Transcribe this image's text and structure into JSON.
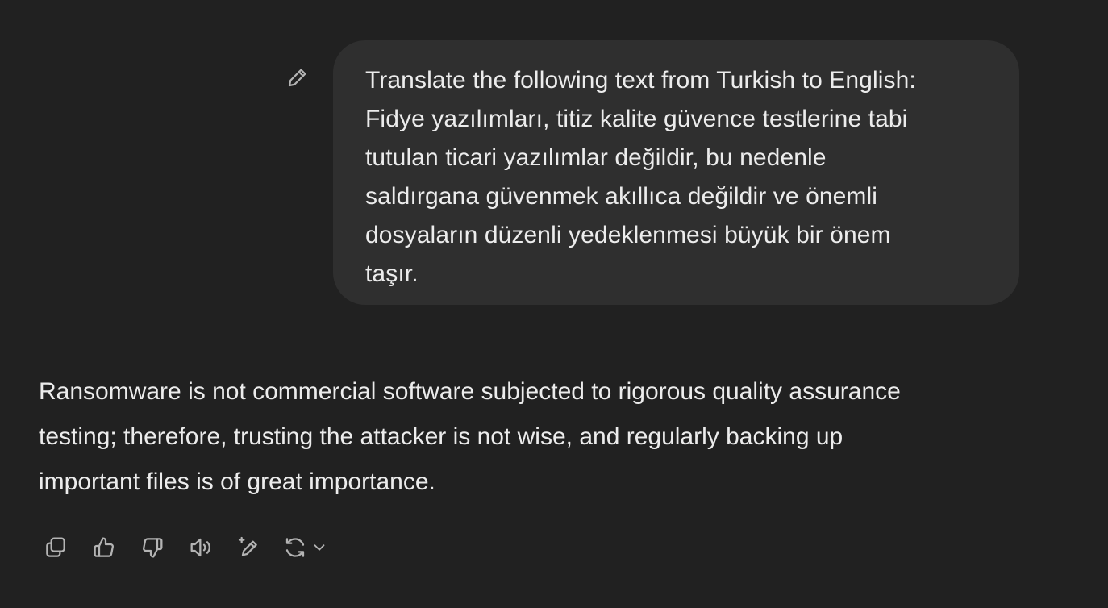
{
  "user_message": {
    "lines": [
      "Translate the following text from Turkish to English:",
      "Fidye yazılımları, titiz kalite güvence testlerine tabi",
      "tutulan ticari yazılımlar değildir, bu nedenle",
      "saldırgana güvenmek akıllıca değildir ve önemli",
      "dosyaların düzenli yedeklenmesi büyük bir önem",
      "taşır."
    ],
    "edit_icon": "pencil-icon"
  },
  "assistant_message": {
    "lines": [
      "Ransomware is not commercial software subjected to rigorous quality assurance",
      "testing; therefore, trusting the attacker is not wise, and regularly backing up",
      "important files is of great importance."
    ]
  },
  "toolbar": {
    "icons": [
      "copy-icon",
      "thumbs-up-icon",
      "thumbs-down-icon",
      "read-aloud-icon",
      "edit-sparkle-icon",
      "regenerate-icon",
      "chevron-down-icon"
    ]
  },
  "colors": {
    "background": "#212121",
    "bubble": "#2f2f2f",
    "text": "#ececec",
    "icon": "#b4b4b4"
  }
}
